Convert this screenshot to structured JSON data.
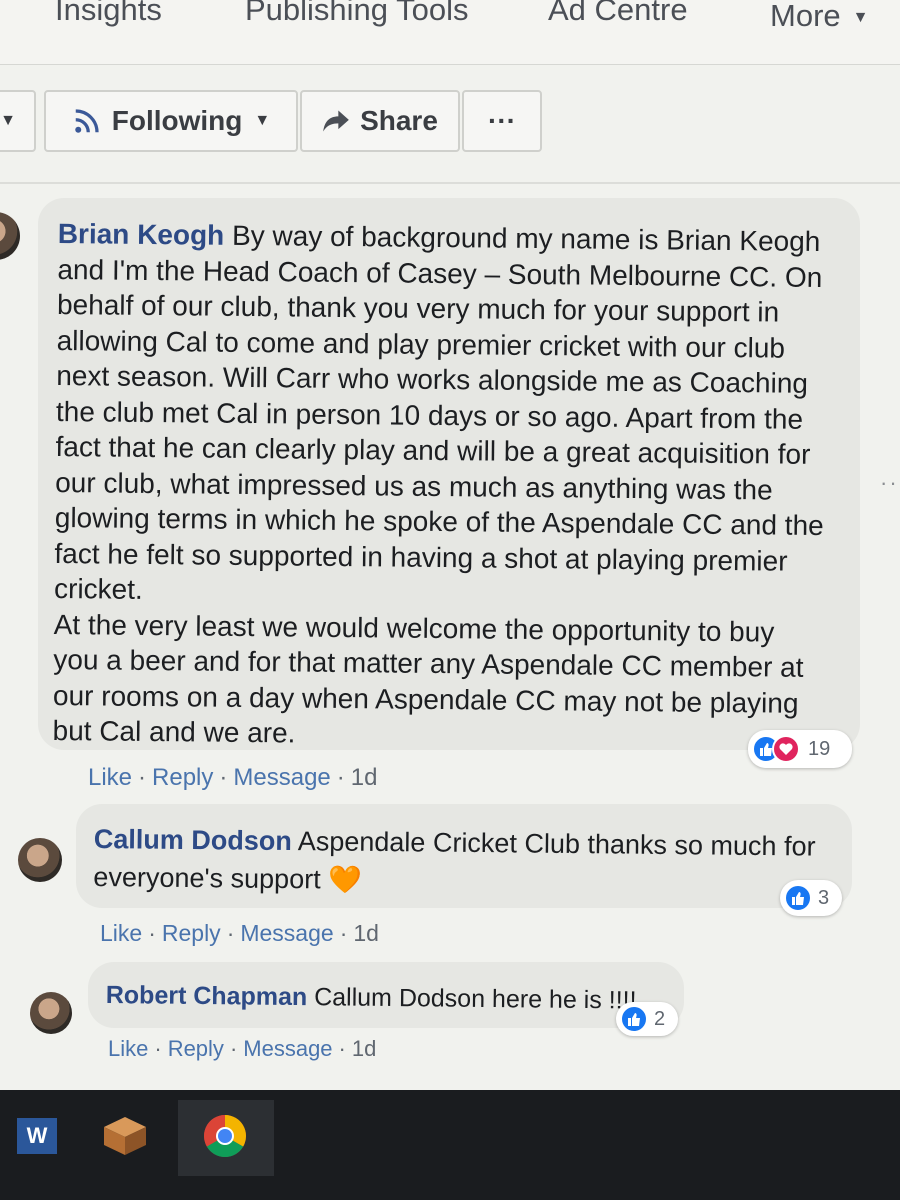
{
  "nav": {
    "items": [
      "Insights",
      "Publishing Tools",
      "Ad Centre",
      "More"
    ]
  },
  "actions": {
    "following": "Following",
    "share": "Share",
    "more": "···"
  },
  "comments": [
    {
      "author": "Brian Keogh",
      "lines": [
        "By way of background my name is Brian Keogh",
        "and I'm the Head Coach of Casey – South Melbourne CC. On",
        "behalf of our club, thank you very much for your support in",
        "allowing Cal to come and play premier cricket with our club",
        "next season. Will Carr who works alongside me as Coaching",
        "the club met Cal in person 10 days or so ago. Apart from the",
        "fact that he can clearly play and will be a great acquisition for",
        "our club, what impressed us as much as anything was the",
        "glowing terms in which he spoke of the Aspendale CC and the",
        "fact he felt so supported in having a shot at playing premier",
        "cricket.",
        "At the very least we would welcome the opportunity to buy",
        "you a beer and for that matter any Aspendale CC member at",
        "our rooms on a day when Aspendale CC may not be playing",
        "but Cal and we are."
      ],
      "reactions": "19",
      "like": "Like",
      "reply": "Reply",
      "message": "Message",
      "time": "1d"
    },
    {
      "author": "Callum Dodson",
      "lines": [
        "Aspendale Cricket Club thanks so much for",
        "everyone's support"
      ],
      "emoji": "🧡",
      "reactions": "3",
      "like": "Like",
      "reply": "Reply",
      "message": "Message",
      "time": "1d"
    },
    {
      "author": "Robert Chapman",
      "lines": [
        "Callum Dodson here he is !!!!"
      ],
      "reactions": "2",
      "like": "Like",
      "reply": "Reply",
      "message": "Message",
      "time": "1d"
    }
  ],
  "taskbar": {
    "word_label": "W"
  }
}
